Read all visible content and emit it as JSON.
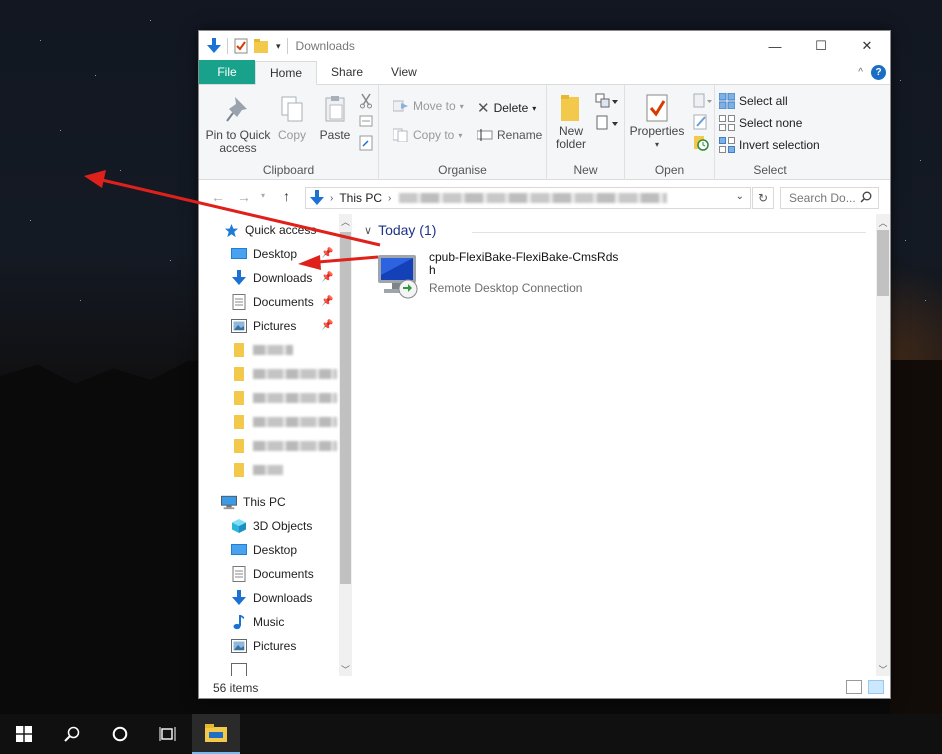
{
  "window": {
    "title": "Downloads",
    "controls": {
      "minimize": "—",
      "maximize": "☐",
      "close": "✕"
    }
  },
  "ribbon_tabs": [
    {
      "label": "File"
    },
    {
      "label": "Home"
    },
    {
      "label": "Share"
    },
    {
      "label": "View"
    }
  ],
  "ribbon": {
    "clipboard": {
      "pin_label": "Pin to Quick access",
      "copy_label": "Copy",
      "paste_label": "Paste",
      "group_label": "Clipboard"
    },
    "organise": {
      "move_to": "Move to",
      "copy_to": "Copy to",
      "delete": "Delete",
      "rename": "Rename",
      "group_label": "Organise"
    },
    "new": {
      "new_folder_1": "New",
      "new_folder_2": "folder",
      "group_label": "New"
    },
    "open": {
      "properties": "Properties",
      "group_label": "Open"
    },
    "select": {
      "select_all": "Select all",
      "select_none": "Select none",
      "invert": "Invert selection",
      "group_label": "Select"
    }
  },
  "address": {
    "root": "This PC",
    "search_placeholder": "Search Do..."
  },
  "nav_pane": {
    "quick_access": "Quick access",
    "quick_items": [
      {
        "label": "Desktop",
        "icon": "desktop-icon",
        "pinned": true
      },
      {
        "label": "Downloads",
        "icon": "download-arrow-icon",
        "pinned": true
      },
      {
        "label": "Documents",
        "icon": "documents-icon",
        "pinned": true
      },
      {
        "label": "Pictures",
        "icon": "pictures-icon",
        "pinned": true
      }
    ],
    "this_pc": "This PC",
    "pc_items": [
      {
        "label": "3D Objects",
        "icon": "cube-icon"
      },
      {
        "label": "Desktop",
        "icon": "desktop-icon"
      },
      {
        "label": "Documents",
        "icon": "documents-icon"
      },
      {
        "label": "Downloads",
        "icon": "download-arrow-icon"
      },
      {
        "label": "Music",
        "icon": "music-note-icon"
      },
      {
        "label": "Pictures",
        "icon": "pictures-icon"
      }
    ]
  },
  "content": {
    "group_header": "Today (1)",
    "file": {
      "name_line1": "cpub-FlexiBake-FlexiBake-CmsRds",
      "name_line2": "h",
      "type": "Remote Desktop Connection",
      "icon": "remote-desktop-icon"
    }
  },
  "status": {
    "items": "56 items"
  },
  "colors": {
    "file_tab": "#19a28b",
    "arrow": "#e0201b",
    "group_header": "#1e3287"
  }
}
